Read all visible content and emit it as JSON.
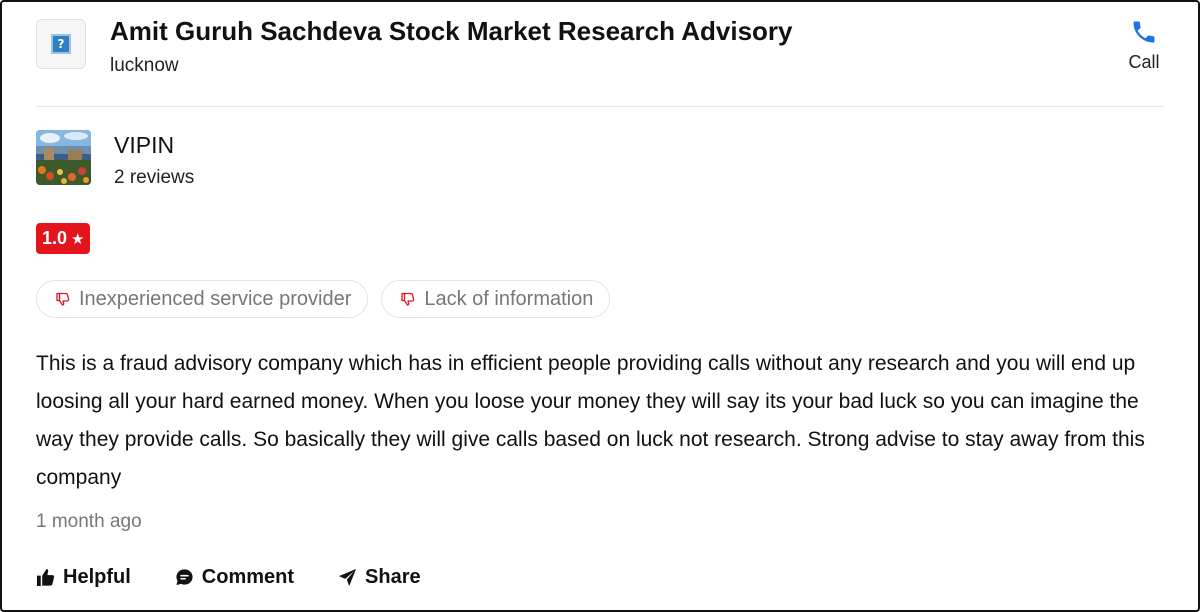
{
  "business": {
    "name": "Amit Guruh Sachdeva Stock Market Research Advisory",
    "city": "lucknow",
    "logo_icon": "question-mark-icon",
    "call_label": "Call",
    "call_icon": "phone-icon",
    "accent": "#1a73e8"
  },
  "review": {
    "reviewer_name": "VIPIN",
    "reviewer_reviews": "2 reviews",
    "rating": "1.0",
    "rating_star": "★",
    "rating_color": "#e3141c",
    "tags": [
      {
        "label": "Inexperienced service provider",
        "icon": "thumbs-down-icon"
      },
      {
        "label": "Lack of information",
        "icon": "thumbs-down-icon"
      }
    ],
    "text": "This is a fraud advisory company which has in efficient people providing calls without any research and you will end up loosing all your hard earned money. When you loose your money they will say its your bad luck so you can imagine the way they provide calls. So basically they will give calls based on luck not research. Strong advise to stay away from this company",
    "time": "1 month ago"
  },
  "actions": {
    "helpful": "Helpful",
    "comment": "Comment",
    "share": "Share"
  }
}
